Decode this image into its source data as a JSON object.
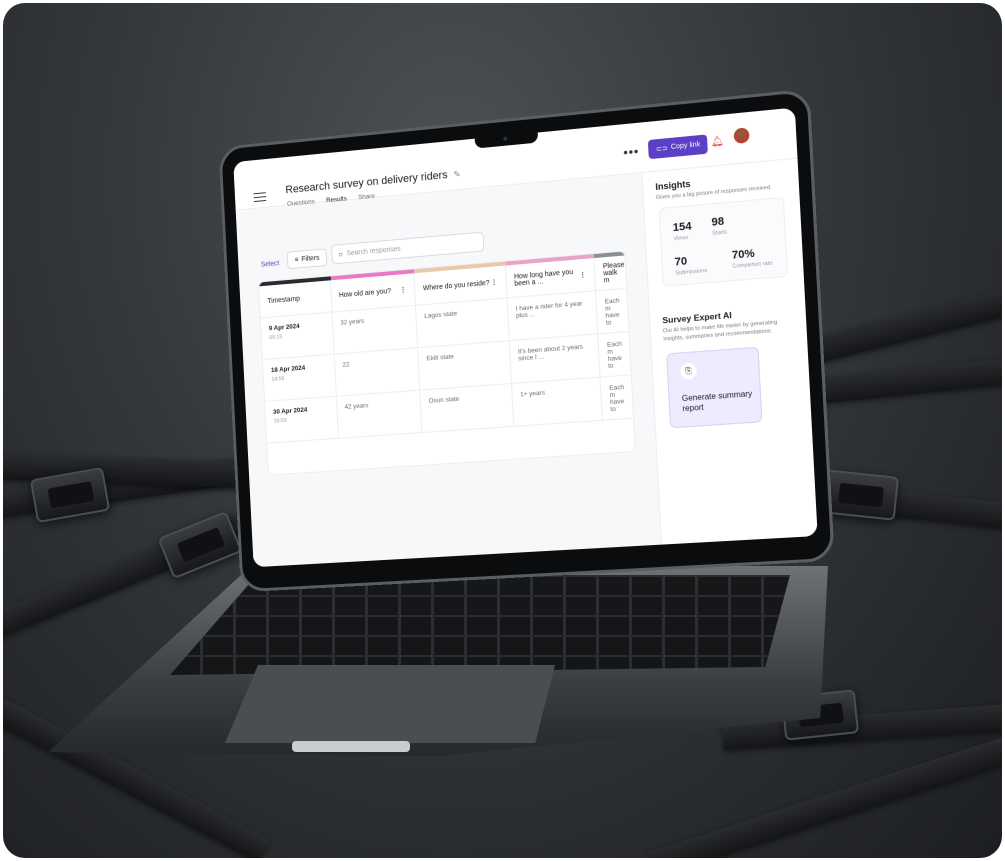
{
  "app": {
    "title": "Research survey on delivery riders",
    "tabs": [
      {
        "label": "Questions",
        "active": false
      },
      {
        "label": "Results",
        "active": true
      },
      {
        "label": "Share",
        "active": false
      }
    ],
    "copy_link_label": "Copy link",
    "more_label": "•••",
    "icons": {
      "menu": "hamburger-icon",
      "edit": "pencil-icon",
      "link": "link-icon",
      "notifications": "bell-icon",
      "profile": "avatar"
    }
  },
  "toolbar": {
    "select_label": "Select",
    "filters_label": "Filters",
    "search_placeholder": "Search responses"
  },
  "table": {
    "headers": [
      "Timestamp",
      "How old are you?",
      "Where do you reside?",
      "How long have you been a ...",
      "Please walk m"
    ],
    "header_colors": [
      "#2b2c2f",
      "#e879c6",
      "#e9c9a9",
      "#e9a3c4",
      "#8a8f95"
    ],
    "rows": [
      {
        "date": "9 Apr 2024",
        "time": "09:15",
        "age": "32 years",
        "reside": "Lagos state",
        "duration": "I have a rider for 4 year plus ...",
        "walk": "Each m have to"
      },
      {
        "date": "18 Apr 2024",
        "time": "14:56",
        "age": "22",
        "reside": "Ekiti state",
        "duration": "It's been about 2 years since I ...",
        "walk": "Each m have to"
      },
      {
        "date": "30 Apr 2024",
        "time": "18:03",
        "age": "42 years",
        "reside": "Osun state",
        "duration": "1+ years",
        "walk": "Each m have to"
      }
    ]
  },
  "insights": {
    "title": "Insights",
    "subtitle": "Gives you a big picture of responses received.",
    "views": {
      "value": "154",
      "label": "Views"
    },
    "starts": {
      "value": "98",
      "label": "Starts"
    },
    "submissions": {
      "value": "70",
      "label": "Submissions"
    },
    "completion": {
      "value": "70%",
      "label": "Completion rate"
    }
  },
  "ai": {
    "title": "Survey Expert AI",
    "subtitle": "Our AI helps to make life easier by generating insights, summaries and recommendations.",
    "generate_label": "Generate summary report"
  },
  "colors": {
    "accent": "#5b3fc4",
    "notification": "#e5484d",
    "card_bg": "#efeafd"
  }
}
